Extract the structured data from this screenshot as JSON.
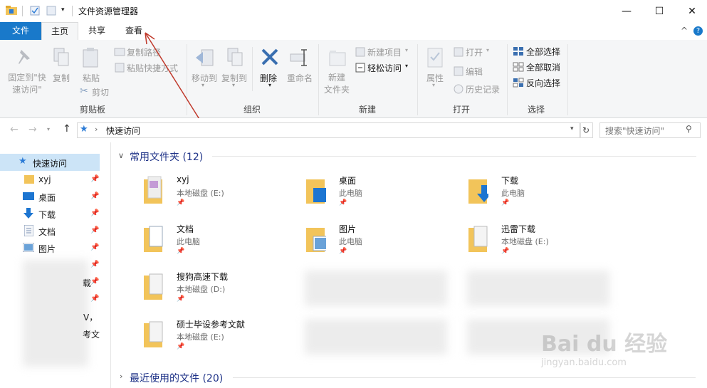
{
  "window": {
    "title": "文件资源管理器",
    "minimize": "—",
    "maximize": "☐",
    "close": "✕"
  },
  "tabs": {
    "file": "文件",
    "home": "主页",
    "share": "共享",
    "view": "查看",
    "collapse": "^",
    "help": "?"
  },
  "ribbon": {
    "pin_quick": "固定到\"快\n速访问\"",
    "copy": "复制",
    "paste": "粘贴",
    "copy_path": "复制路径",
    "paste_shortcut": "粘贴快捷方式",
    "cut": "剪切",
    "clipboard_group": "剪贴板",
    "move_to": "移动到",
    "copy_to": "复制到",
    "delete": "删除",
    "rename": "重命名",
    "organize_group": "组织",
    "new_folder": "新建\n文件夹",
    "new_item": "新建项目",
    "easy_access": "轻松访问",
    "new_group": "新建",
    "properties": "属性",
    "open": "打开",
    "edit": "编辑",
    "history": "历史记录",
    "open_group": "打开",
    "select_all": "全部选择",
    "select_none": "全部取消",
    "invert_selection": "反向选择",
    "select_group": "选择"
  },
  "address": {
    "path": "快速访问",
    "search_placeholder": "搜索\"快速访问\""
  },
  "nav": {
    "quick_access": "快速访问",
    "items": [
      {
        "label": "xyj"
      },
      {
        "label": "桌面"
      },
      {
        "label": "下载"
      },
      {
        "label": "文档"
      },
      {
        "label": "图片"
      }
    ],
    "partial_text_1": "载",
    "partial_text_2": "V，",
    "partial_text_3": "考文"
  },
  "content": {
    "frequent_header": "常用文件夹 (12)",
    "recent_header": "最近使用的文件 (20)",
    "folders": [
      {
        "name": "xyj",
        "location": "本地磁盘 (E:)"
      },
      {
        "name": "桌面",
        "location": "此电脑"
      },
      {
        "name": "下载",
        "location": "此电脑"
      },
      {
        "name": "文档",
        "location": "此电脑"
      },
      {
        "name": "图片",
        "location": "此电脑"
      },
      {
        "name": "迅雷下载",
        "location": "本地磁盘 (E:)"
      },
      {
        "name": "搜狗高速下载",
        "location": "本地磁盘 (D:)"
      },
      {
        "name": "硕士毕设参考文献",
        "location": "本地磁盘 (E:)"
      }
    ]
  },
  "watermark": {
    "brand": "Bai du 经验",
    "url": "jingyan.baidu.com"
  },
  "colors": {
    "accent": "#1979ca",
    "arrow": "#c0392b",
    "folder": "#f2c45a"
  }
}
